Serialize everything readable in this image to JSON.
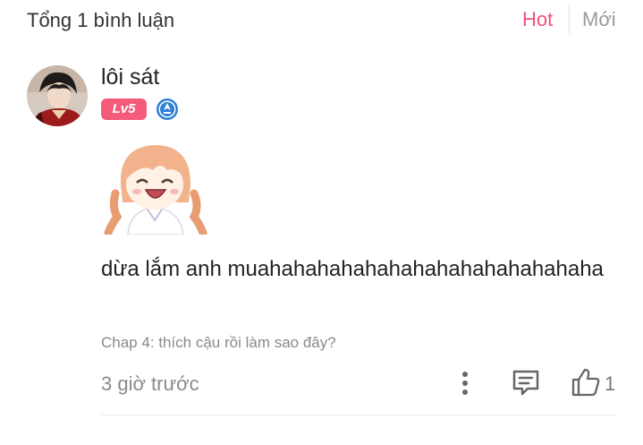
{
  "header": {
    "total_label": "Tổng 1 bình luận",
    "sort_hot": "Hot",
    "sort_new": "Mới"
  },
  "comment": {
    "username": "lôi sát",
    "level": "Lv5",
    "text": "dừa lắm anh muahahahahahahahahahahahahahaha",
    "chapter": "Chap 4: thích cậu rồi làm sao đây?",
    "time": "3 giờ trước",
    "likes": "1"
  },
  "colors": {
    "accent": "#f0507a",
    "muted": "#8a8a8a",
    "level_badge": "#f45b7a",
    "rank_icon": "#2e7fd6"
  },
  "icons": {
    "more": "more-vertical-icon",
    "reply": "comment-reply-icon",
    "like": "thumbs-up-icon",
    "rank": "rank-badge-icon"
  }
}
